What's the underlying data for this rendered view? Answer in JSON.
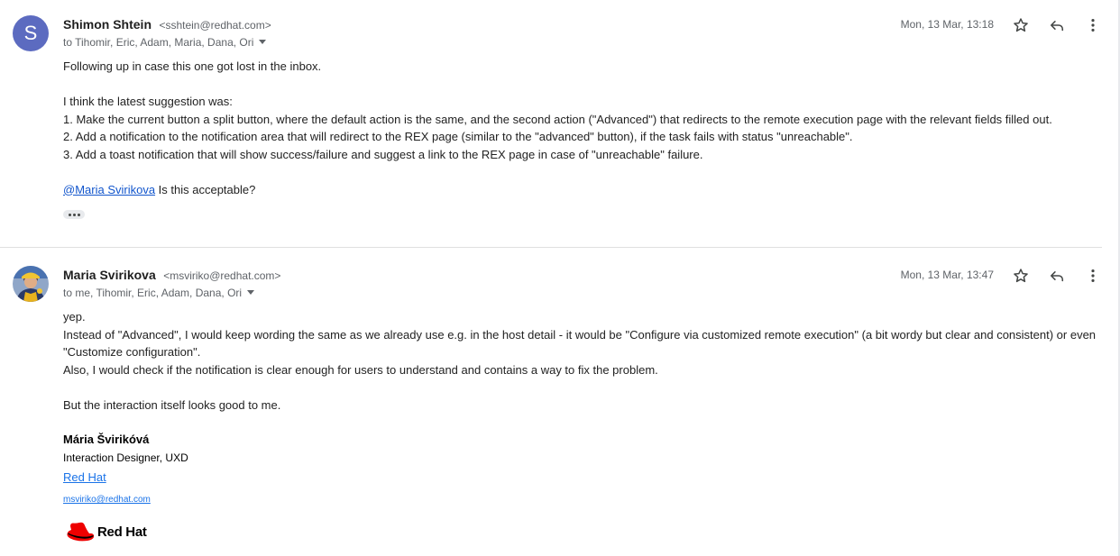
{
  "thread": {
    "messages": [
      {
        "avatar_initial": "S",
        "avatar_color": "#5c6bc0",
        "sender_name": "Shimon Shtein",
        "sender_email": "<sshtein@redhat.com>",
        "recipients": "to Tihomir, Eric, Adam, Maria, Dana, Ori",
        "date": "Mon, 13 Mar, 13:18",
        "body": {
          "line1": "Following up in case this one got lost in the inbox.",
          "line2": "I think the latest suggestion was:",
          "line3": "1. Make the current button a split button, where the default action is the same, and the second action (\"Advanced\") that redirects to the remote execution page with the relevant fields filled out.",
          "line4": "2. Add a notification to the notification area that will redirect to the REX page (similar to the \"advanced\" button), if the task fails with status \"unreachable\".",
          "line5": "3. Add a toast notification that will show success/failure and suggest a link to the REX page in case of \"unreachable\" failure.",
          "mention": "@Maria Svirikova",
          "mention_suffix": " Is this acceptable?"
        }
      },
      {
        "sender_name": "Maria Svirikova",
        "sender_email": "<msviriko@redhat.com>",
        "recipients": "to me, Tihomir, Eric, Adam, Dana, Ori",
        "date": "Mon, 13 Mar, 13:47",
        "body": {
          "line1": "yep.",
          "line2": "Instead of \"Advanced\", I would keep wording the same as we already use e.g. in the host detail - it would be \"Configure via customized remote execution\" (a bit wordy but clear and consistent) or even \"Customize configuration\".",
          "line3": "Also, I would check if the notification is clear enough for users to understand and contains a way to fix the problem.",
          "line4": "But the interaction itself looks good to me."
        },
        "signature": {
          "name": "Mária Švirikóvá",
          "title": "Interaction Designer, UXD",
          "company": "Red Hat",
          "email": "msviriko@redhat.com",
          "logo_text": "Red Hat",
          "logo_color": "#ee0000"
        }
      }
    ]
  },
  "icons": {
    "star": "star-icon",
    "reply": "reply-icon",
    "more": "more-vert-icon",
    "trim": "show-trimmed-content-icon"
  }
}
